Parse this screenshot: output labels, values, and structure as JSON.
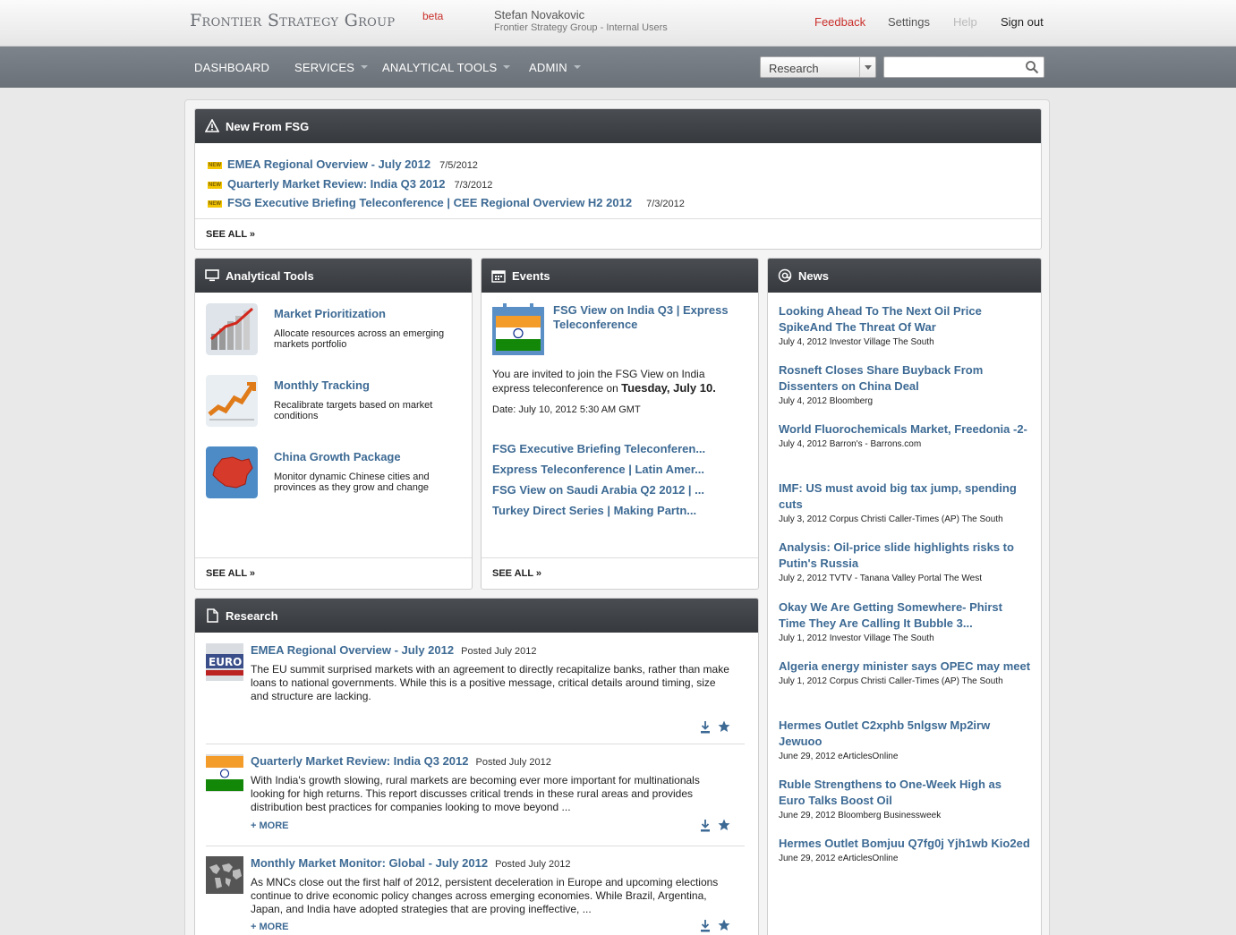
{
  "header": {
    "logo": "Frontier Strategy Group",
    "beta": "beta",
    "user_name": "Stefan Novakovic",
    "user_org": "Frontier Strategy Group - Internal Users",
    "links": {
      "feedback": "Feedback",
      "settings": "Settings",
      "help": "Help",
      "signout": "Sign out"
    }
  },
  "nav": {
    "items": [
      "DASHBOARD",
      "SERVICES",
      "ANALYTICAL TOOLS",
      "ADMIN"
    ],
    "search_scope": "Research",
    "search_placeholder": ""
  },
  "new_from_fsg": {
    "title": "New From FSG",
    "items": [
      {
        "title": "EMEA Regional Overview - July 2012",
        "date": "7/5/2012"
      },
      {
        "title": "Quarterly Market Review: India Q3 2012",
        "date": "7/3/2012"
      },
      {
        "title": "FSG Executive Briefing Teleconference | CEE Regional Overview H2 2012",
        "date": "7/3/2012"
      }
    ],
    "see_all": "SEE ALL »"
  },
  "analytical_tools": {
    "title": "Analytical Tools",
    "items": [
      {
        "title": "Market Prioritization",
        "desc": "Allocate resources across an emerging markets portfolio"
      },
      {
        "title": "Monthly Tracking",
        "desc": "Recalibrate targets based on market conditions"
      },
      {
        "title": "China Growth Package",
        "desc": "Monitor dynamic Chinese cities and provinces as they grow and change"
      }
    ],
    "see_all": "SEE ALL »"
  },
  "events": {
    "title": "Events",
    "featured_title": "FSG View on India Q3 | Express Teleconference",
    "featured_body_pre": "You are invited to join the FSG View on India express teleconference on ",
    "featured_body_bold": "Tuesday, July 10.",
    "featured_date": "Date: July 10, 2012 5:30 AM GMT",
    "links": [
      "FSG Executive Briefing Teleconferen...",
      "Express Teleconference | Latin Amer...",
      "FSG View on Saudi Arabia Q2 2012 | ...",
      "Turkey Direct Series | Making Partn..."
    ],
    "see_all": "SEE ALL »"
  },
  "news": {
    "title": "News",
    "items": [
      {
        "title": "Looking Ahead To The Next Oil Price SpikeAnd The Threat Of War",
        "meta": "July 4, 2012 Investor Village The South"
      },
      {
        "title": "Rosneft Closes Share Buyback From Dissenters on China Deal",
        "meta": "July 4, 2012 Bloomberg"
      },
      {
        "title": "World Fluorochemicals Market, Freedonia -2-",
        "meta": "July 4, 2012 Barron's - Barrons.com"
      },
      {
        "title": "IMF: US must avoid big tax jump, spending cuts",
        "meta": "July 3, 2012 Corpus Christi Caller-Times (AP) The South"
      },
      {
        "title": "Analysis: Oil-price slide highlights risks to Putin's Russia",
        "meta": "July 2, 2012 TVTV - Tanana Valley Portal The West"
      },
      {
        "title": "Okay We Are Getting Somewhere- Phirst Time They Are Calling It Bubble 3...",
        "meta": "July 1, 2012 Investor Village The South"
      },
      {
        "title": "Algeria energy minister says OPEC may meet",
        "meta": "July 1, 2012 Corpus Christi Caller-Times (AP) The South"
      },
      {
        "title": "Hermes Outlet C2xphb 5nlgsw Mp2irw Jewuoo",
        "meta": "June 29, 2012 eArticlesOnline"
      },
      {
        "title": "Ruble Strengthens to One-Week High as Euro Talks Boost Oil",
        "meta": "June 29, 2012 Bloomberg Businessweek"
      },
      {
        "title": "Hermes Outlet Bomjuu Q7fg0j Yjh1wb Kio2ed",
        "meta": "June 29, 2012 eArticlesOnline"
      }
    ]
  },
  "research": {
    "title": "Research",
    "items": [
      {
        "title": "EMEA Regional Overview - July 2012",
        "posted": "Posted July 2012",
        "body": "The EU summit surprised markets with an agreement to directly recapitalize banks, rather than make loans to national governments. While this is a positive message, critical details around timing, size and structure are lacking.",
        "more": ""
      },
      {
        "title": "Quarterly Market Review: India Q3 2012",
        "posted": "Posted July 2012",
        "body": "With India's growth slowing, rural markets are becoming ever more important for multinationals looking for high returns. This report discusses critical trends in these rural areas and provides distribution best practices for companies looking to move beyond ...",
        "more": "+ MORE"
      },
      {
        "title": "Monthly Market Monitor: Global - July 2012",
        "posted": "Posted July 2012",
        "body": "As MNCs close out the first half of 2012, persistent deceleration in Europe and upcoming elections continue to drive economic policy changes across emerging economies. While Brazil, Argentina, Japan, and India have adopted strategies that are proving ineffective, ...",
        "more": "+ MORE"
      }
    ]
  },
  "colors": {
    "link": "#3d6a94",
    "accent_red": "#c9302c",
    "nav_bg": "#737a81",
    "panel_head": "#3f4246"
  }
}
